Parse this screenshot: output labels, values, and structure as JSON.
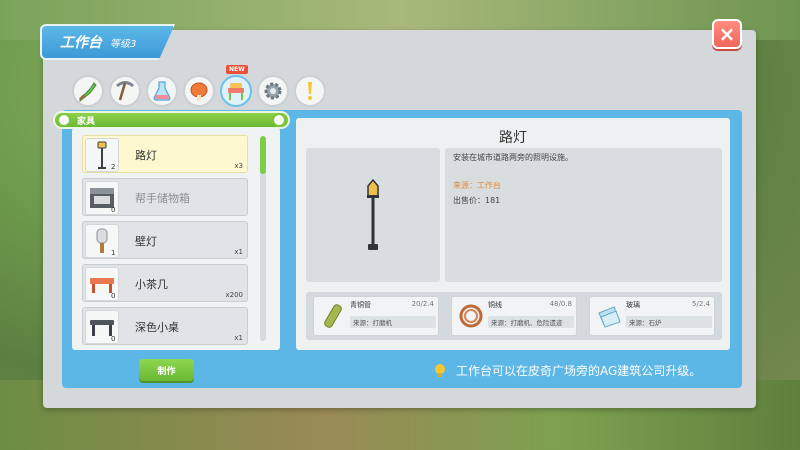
{
  "window": {
    "title": "工作台",
    "level": "等级3",
    "close_label": "×"
  },
  "categories": {
    "items": [
      {
        "icon": "sword-icon"
      },
      {
        "icon": "pickaxe-icon"
      },
      {
        "icon": "flask-icon"
      },
      {
        "icon": "roast-chicken-icon"
      },
      {
        "icon": "furniture-icon",
        "badge": "NEW"
      },
      {
        "icon": "gear-icon"
      },
      {
        "icon": "exclamation-icon"
      }
    ],
    "active_label": "家具"
  },
  "item_list": [
    {
      "name": "路灯",
      "count": "2",
      "qty": "x3",
      "selected": true,
      "icon": "street-lamp-icon"
    },
    {
      "name": "帮手储物箱",
      "count": "0",
      "qty": "",
      "dim": true,
      "icon": "storage-box-icon"
    },
    {
      "name": "壁灯",
      "count": "1",
      "qty": "x1",
      "icon": "wall-lamp-icon"
    },
    {
      "name": "小茶几",
      "count": "0",
      "qty": "x200",
      "icon": "tea-table-icon"
    },
    {
      "name": "深色小桌",
      "count": "0",
      "qty": "x1",
      "icon": "dark-table-icon"
    }
  ],
  "craft_button": "制作",
  "detail": {
    "title": "路灯",
    "description": "安装在城市道路两旁的照明设施。",
    "source": "来源：工作台",
    "price": "出售价：181"
  },
  "materials": [
    {
      "name": "青铜管",
      "count": "20/2.4",
      "source": "来源：打磨机",
      "icon": "bronze-pipe-icon"
    },
    {
      "name": "铜线",
      "count": "48/0.8",
      "source": "来源：打磨机、危险遗迹",
      "icon": "copper-wire-icon"
    },
    {
      "name": "玻璃",
      "count": "5/2.4",
      "source": "来源：石炉",
      "icon": "glass-icon"
    }
  ],
  "hint": "工作台可以在皮奇广场旁的AG建筑公司升级。"
}
